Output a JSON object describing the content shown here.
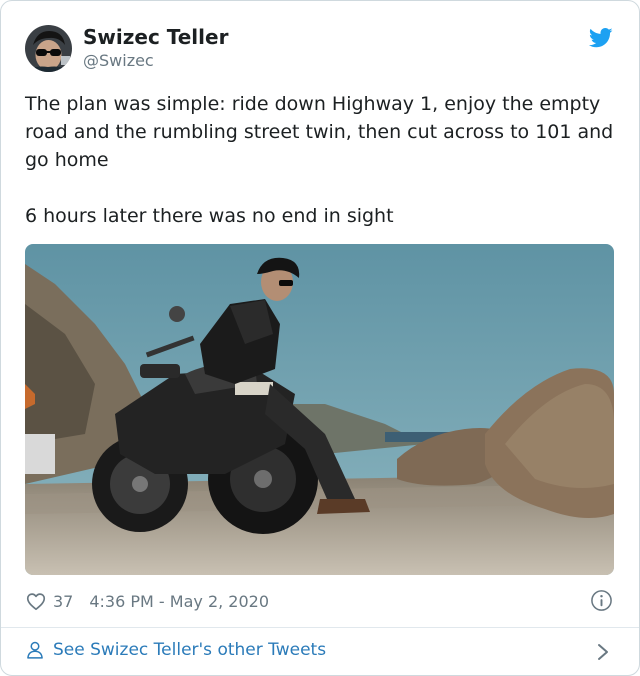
{
  "author": {
    "name": "Swizec Teller",
    "handle": "@Swizec"
  },
  "tweet": {
    "paragraphs": [
      "The plan was simple: ride down Highway 1, enjoy the empty road and the rumbling street twin, then cut across to 101 and go home",
      "6 hours later there was no end in sight"
    ]
  },
  "meta": {
    "likes": "37",
    "timestamp": "4:36 PM - May 2, 2020"
  },
  "footer": {
    "link_text": "See Swizec Teller's other Tweets"
  },
  "icons": {
    "brand": "twitter-bird-icon",
    "like": "heart-icon",
    "info": "info-icon",
    "profile": "person-icon",
    "next": "chevron-right-icon"
  },
  "colors": {
    "twitter_blue": "#1da1f2",
    "link_blue": "#2b7bb9",
    "muted_text": "#697882",
    "primary_text": "#1c2022"
  }
}
